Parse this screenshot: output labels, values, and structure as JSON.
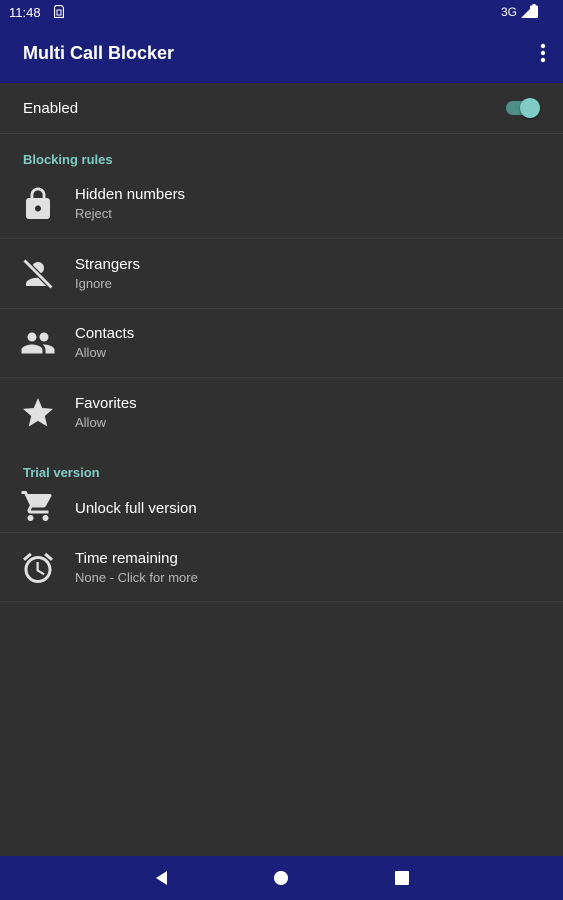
{
  "status_bar": {
    "time": "11:48",
    "network": "3G",
    "icons": [
      "sim-card-icon",
      "signal-icon",
      "battery-icon"
    ]
  },
  "app_bar": {
    "title": "Multi Call Blocker",
    "menu_icon": "more-vert-icon"
  },
  "enabled": {
    "label": "Enabled",
    "toggled": true
  },
  "blocking_rules": {
    "header": "Blocking rules",
    "items": [
      {
        "icon": "lock-icon",
        "title": "Hidden numbers",
        "value": "Reject"
      },
      {
        "icon": "person-off-icon",
        "title": "Strangers",
        "value": "Ignore"
      },
      {
        "icon": "people-icon",
        "title": "Contacts",
        "value": "Allow"
      },
      {
        "icon": "star-icon",
        "title": "Favorites",
        "value": "Allow"
      }
    ]
  },
  "trial": {
    "header": "Trial version",
    "unlock": {
      "icon": "cart-icon",
      "title": "Unlock full version"
    },
    "remaining": {
      "icon": "alarm-icon",
      "title": "Time remaining",
      "value": "None - Click for more"
    }
  },
  "colors": {
    "primary": "#1a1f7a",
    "accent": "#80cbc4",
    "background": "#303030",
    "icon": "#e0e0e0"
  },
  "nav_bar": {
    "icons": [
      "back-icon",
      "home-icon",
      "recents-icon"
    ]
  }
}
